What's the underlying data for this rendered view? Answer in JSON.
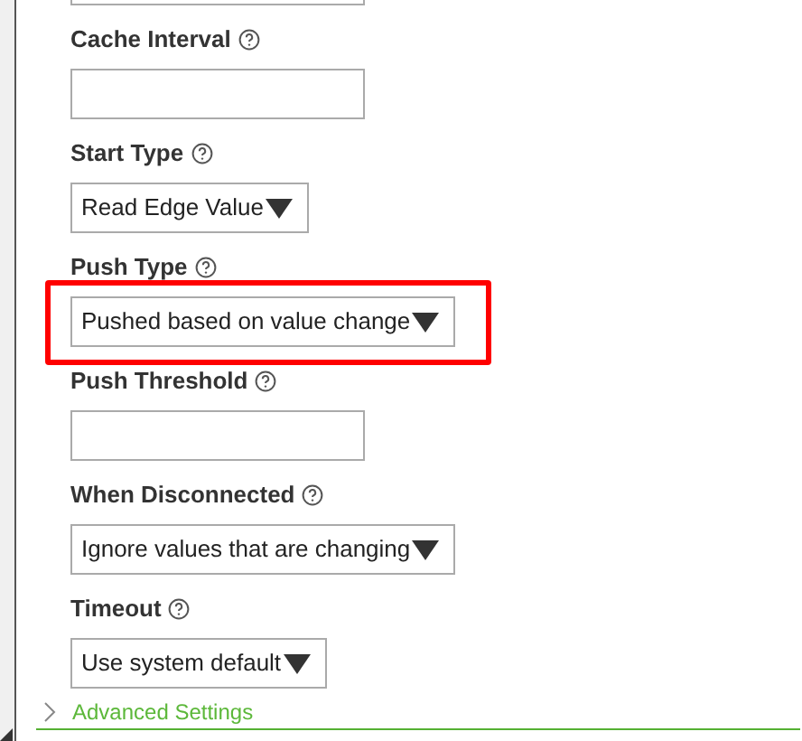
{
  "fields": [
    {
      "label": "Cache Interval",
      "kind": "text",
      "highlighted": false
    },
    {
      "label": "Start Type",
      "kind": "select",
      "value": "Read Edge Value",
      "highlighted": false
    },
    {
      "label": "Push Type",
      "kind": "select",
      "value": "Pushed based on value change",
      "highlighted": true
    },
    {
      "label": "Push Threshold",
      "kind": "text",
      "highlighted": false
    },
    {
      "label": "When Disconnected",
      "kind": "select",
      "value": "Ignore values that are changing",
      "highlighted": false
    },
    {
      "label": "Timeout",
      "kind": "select",
      "value": "Use system default",
      "highlighted": false
    }
  ],
  "advanced": {
    "label": "Advanced Settings",
    "expanded": false
  }
}
